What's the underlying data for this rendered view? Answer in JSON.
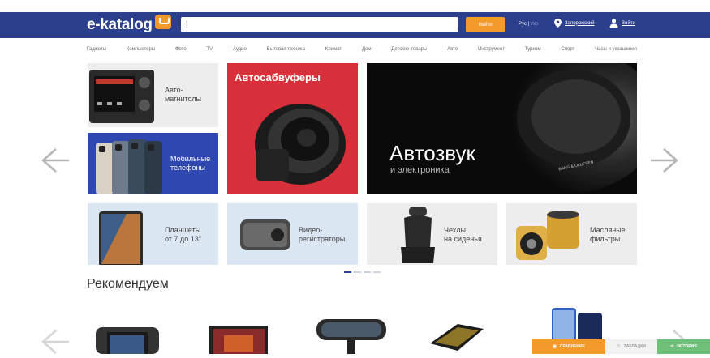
{
  "header": {
    "logo_text": "e-katalog",
    "search_value": "|",
    "search_button": "Найти",
    "lang_ru": "Рус",
    "lang_ua": "Укр",
    "city": "Запорожский",
    "login": "Войти"
  },
  "nav": [
    "Гаджеты",
    "Компьютеры",
    "Фото",
    "TV",
    "Аудио",
    "Бытовая техника",
    "Климат",
    "Дом",
    "Детские товары",
    "Авто",
    "Инструмент",
    "Туризм",
    "Спорт",
    "Часы и украшения"
  ],
  "banners": {
    "car_radio": "Авто-\nмагнитолы",
    "subwoofers": "Автосабвуферы",
    "audio_title": "Автозвук",
    "audio_sub": "и электроника",
    "audio_brand": "BANG & OLUFSEN",
    "phones": "Мобильные\nтелефоны",
    "tablets": "Планшеты\nот 7 до 13\"",
    "dvr": "Видео-\nрегистраторы",
    "seat_covers": "Чехлы\nна сиденья",
    "oil_filters": "Масляные\nфильтры"
  },
  "recommend_title": "Рекомендуем",
  "bottom_bar": {
    "compare": "СРАВНЕНИЕ",
    "bookmarks": "ЗАКЛАДКИ",
    "history": "ИСТОРИЯ"
  },
  "colors": {
    "header_bg": "#2b3f8c",
    "accent": "#f39a2b",
    "subwoofer_bg": "#d8303a",
    "phones_bg": "#2f47b0",
    "history_bg": "#6fc17a"
  }
}
